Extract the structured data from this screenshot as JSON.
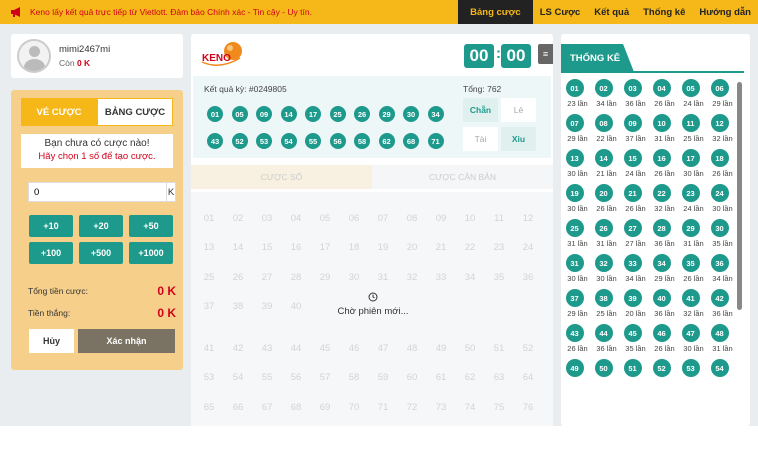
{
  "topbar": {
    "announcement": "Keno lấy kết quả trực tiếp từ Vietlott. Đảm bảo Chính xác - Tin cậy - Uy tín.",
    "menu": [
      {
        "label": "Bảng cược",
        "active": true
      },
      {
        "label": "LS Cược",
        "active": false
      },
      {
        "label": "Kết quả",
        "active": false
      },
      {
        "label": "Thống kê",
        "active": false
      },
      {
        "label": "Hướng dẫn",
        "active": false
      }
    ]
  },
  "user": {
    "name": "mimi2467mi",
    "balance_label": "Còn",
    "balance_value": "0 K"
  },
  "bet_panel": {
    "tab_ticket": "VÉ CƯỢC",
    "tab_board": "BẢNG CƯỢC",
    "no_bet_line1": "Bạn chưa có cược nào!",
    "no_bet_line2": "Hãy chọn 1 số để tạo cược.",
    "amount_value": "0",
    "amount_unit": "K",
    "chips": [
      "+10",
      "+20",
      "+50",
      "+100",
      "+500",
      "+1000"
    ],
    "total_bet_label": "Tổng tiền cược:",
    "total_bet_value": "0 K",
    "win_label": "Tiền thắng:",
    "win_value": "0 K",
    "cancel_label": "Hủy",
    "confirm_label": "Xác nhận"
  },
  "game": {
    "logo_text": "KENO",
    "timer_minutes": "00",
    "timer_seconds": "00",
    "result_title": "Kết quả kỳ: #0249805",
    "result_total": "Tổng: 762",
    "result_balls": [
      "01",
      "05",
      "09",
      "14",
      "17",
      "25",
      "26",
      "29",
      "30",
      "34",
      "43",
      "52",
      "53",
      "54",
      "55",
      "56",
      "58",
      "62",
      "68",
      "71"
    ],
    "tags": {
      "even": "Chẵn",
      "odd": "Lẻ",
      "big": "Tài",
      "small": "Xỉu"
    },
    "tab_number": "CƯỢC SỐ",
    "tab_basic": "CƯỢC CĂN BẢN",
    "waiting_text": "Chờ phiên mới...",
    "board_numbers": [
      "01",
      "02",
      "03",
      "04",
      "05",
      "06",
      "07",
      "08",
      "09",
      "10",
      "11",
      "12",
      "13",
      "14",
      "15",
      "16",
      "17",
      "18",
      "19",
      "20",
      "21",
      "22",
      "23",
      "24",
      "25",
      "26",
      "27",
      "28",
      "29",
      "30",
      "31",
      "32",
      "33",
      "34",
      "35",
      "36",
      "37",
      "38",
      "39",
      "40"
    ],
    "board_numbers_bottom": [
      "41",
      "42",
      "43",
      "44",
      "45",
      "46",
      "47",
      "48",
      "49",
      "50",
      "51",
      "52",
      "53",
      "54",
      "55",
      "56",
      "57",
      "58",
      "59",
      "60",
      "61",
      "62",
      "63",
      "64",
      "65",
      "66",
      "67",
      "68",
      "69",
      "70",
      "71",
      "72",
      "73",
      "74",
      "75",
      "76"
    ]
  },
  "stats": {
    "title": "THỐNG KÊ",
    "items": [
      {
        "n": "01",
        "c": "23 lần"
      },
      {
        "n": "02",
        "c": "34 lần"
      },
      {
        "n": "03",
        "c": "36 lần"
      },
      {
        "n": "04",
        "c": "26 lần"
      },
      {
        "n": "05",
        "c": "24 lần"
      },
      {
        "n": "06",
        "c": "29 lần"
      },
      {
        "n": "07",
        "c": "29 lần"
      },
      {
        "n": "08",
        "c": "22 lần"
      },
      {
        "n": "09",
        "c": "37 lần"
      },
      {
        "n": "10",
        "c": "31 lần"
      },
      {
        "n": "11",
        "c": "25 lần"
      },
      {
        "n": "12",
        "c": "32 lần"
      },
      {
        "n": "13",
        "c": "30 lần"
      },
      {
        "n": "14",
        "c": "21 lần"
      },
      {
        "n": "15",
        "c": "24 lần"
      },
      {
        "n": "16",
        "c": "26 lần"
      },
      {
        "n": "17",
        "c": "30 lần"
      },
      {
        "n": "18",
        "c": "26 lần"
      },
      {
        "n": "19",
        "c": "30 lần"
      },
      {
        "n": "20",
        "c": "26 lần"
      },
      {
        "n": "21",
        "c": "26 lần"
      },
      {
        "n": "22",
        "c": "32 lần"
      },
      {
        "n": "23",
        "c": "24 lần"
      },
      {
        "n": "24",
        "c": "30 lần"
      },
      {
        "n": "25",
        "c": "31 lần"
      },
      {
        "n": "26",
        "c": "31 lần"
      },
      {
        "n": "27",
        "c": "27 lần"
      },
      {
        "n": "28",
        "c": "36 lần"
      },
      {
        "n": "29",
        "c": "31 lần"
      },
      {
        "n": "30",
        "c": "35 lần"
      },
      {
        "n": "31",
        "c": "30 lần"
      },
      {
        "n": "32",
        "c": "30 lần"
      },
      {
        "n": "33",
        "c": "34 lần"
      },
      {
        "n": "34",
        "c": "29 lần"
      },
      {
        "n": "35",
        "c": "26 lần"
      },
      {
        "n": "36",
        "c": "34 lần"
      },
      {
        "n": "37",
        "c": "29 lần"
      },
      {
        "n": "38",
        "c": "25 lần"
      },
      {
        "n": "39",
        "c": "20 lần"
      },
      {
        "n": "40",
        "c": "36 lần"
      },
      {
        "n": "41",
        "c": "32 lần"
      },
      {
        "n": "42",
        "c": "36 lần"
      },
      {
        "n": "43",
        "c": "26 lần"
      },
      {
        "n": "44",
        "c": "36 lần"
      },
      {
        "n": "45",
        "c": "35 lần"
      },
      {
        "n": "46",
        "c": "26 lần"
      },
      {
        "n": "47",
        "c": "30 lần"
      },
      {
        "n": "48",
        "c": "31 lần"
      },
      {
        "n": "49",
        "c": ""
      },
      {
        "n": "50",
        "c": ""
      },
      {
        "n": "51",
        "c": ""
      },
      {
        "n": "52",
        "c": ""
      },
      {
        "n": "53",
        "c": ""
      },
      {
        "n": "54",
        "c": ""
      }
    ]
  },
  "colors": {
    "accent": "#1e9a8c",
    "brand": "#f6b818",
    "danger": "#d0021b"
  }
}
